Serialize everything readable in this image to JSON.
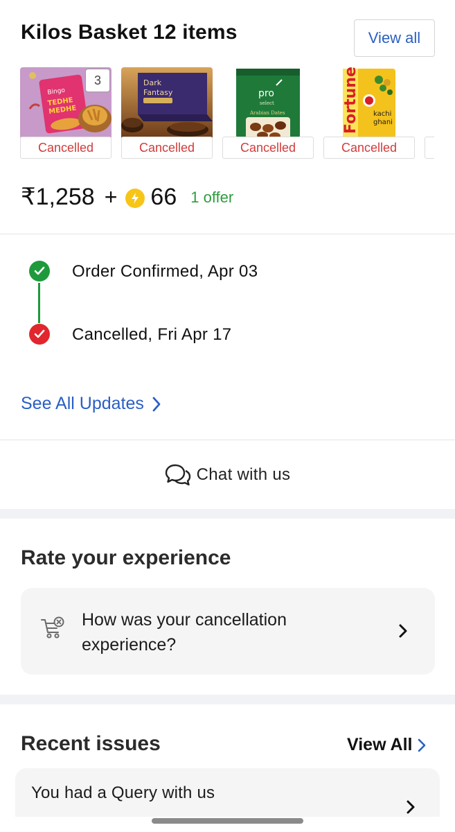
{
  "basket": {
    "title": "Kilos Basket 12 items",
    "view_all_label": "View all",
    "products": [
      {
        "name": "Bingo Tedhe Medhe snack",
        "status": "Cancelled",
        "qty_badge": "3"
      },
      {
        "name": "Dark Fantasy Yumfills Pie",
        "status": "Cancelled"
      },
      {
        "name": "Pro Select Arabian Dates",
        "status": "Cancelled"
      },
      {
        "name": "Fortune Kachi Ghani Mustard Oil",
        "status": "Cancelled"
      }
    ],
    "price": "₹1,258",
    "plus": "+",
    "supercoins": "66",
    "offer": "1 offer",
    "colors": {
      "link": "#2a5fc4",
      "cancelled": "#d23b3b",
      "offer": "#2e9c3e",
      "coin": "#f6c518"
    }
  },
  "timeline": {
    "steps": [
      {
        "label": "Order Confirmed, Apr 03",
        "status": "done",
        "color": "#1e9a3c"
      },
      {
        "label": "Cancelled, Fri Apr 17",
        "status": "cancelled",
        "color": "#e1262d"
      }
    ],
    "see_all_label": "See All Updates"
  },
  "chat": {
    "label": "Chat with us",
    "icon": "chat-bubbles-icon"
  },
  "rate": {
    "title": "Rate your experience",
    "prompt": "How was your cancellation experience?",
    "icon": "cart-cancel-icon"
  },
  "recent": {
    "title": "Recent issues",
    "view_all_label": "View All",
    "issues": [
      {
        "text": "You had a Query with us"
      }
    ]
  }
}
